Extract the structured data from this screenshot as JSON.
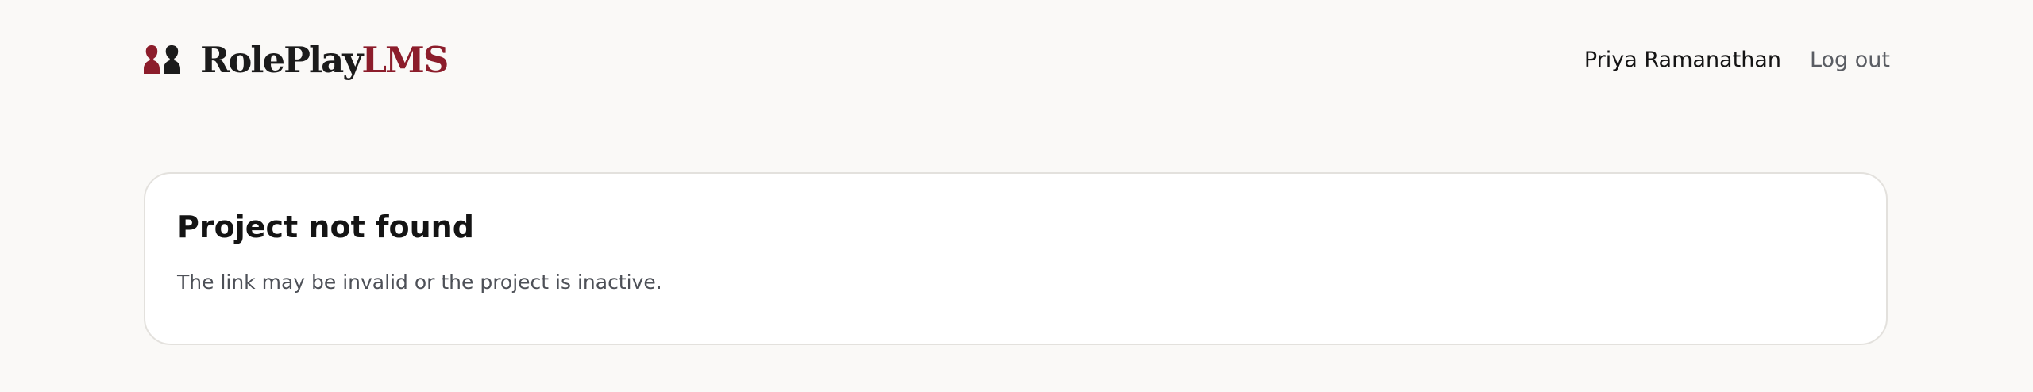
{
  "header": {
    "logo_icon": "two-person-silhouettes-icon",
    "brand_part1": "RolePlay",
    "brand_part2": "LMS",
    "user_name": "Priya Ramanathan",
    "logout_label": "Log out"
  },
  "message": {
    "title": "Project not found",
    "body": "The link may be invalid or the project is inactive."
  },
  "colors": {
    "page_background": "#faf9f7",
    "card_background": "#ffffff",
    "brand_accent": "#8c1d2b",
    "brand_dark": "#1b1b1b",
    "muted_text": "#4d5057"
  }
}
